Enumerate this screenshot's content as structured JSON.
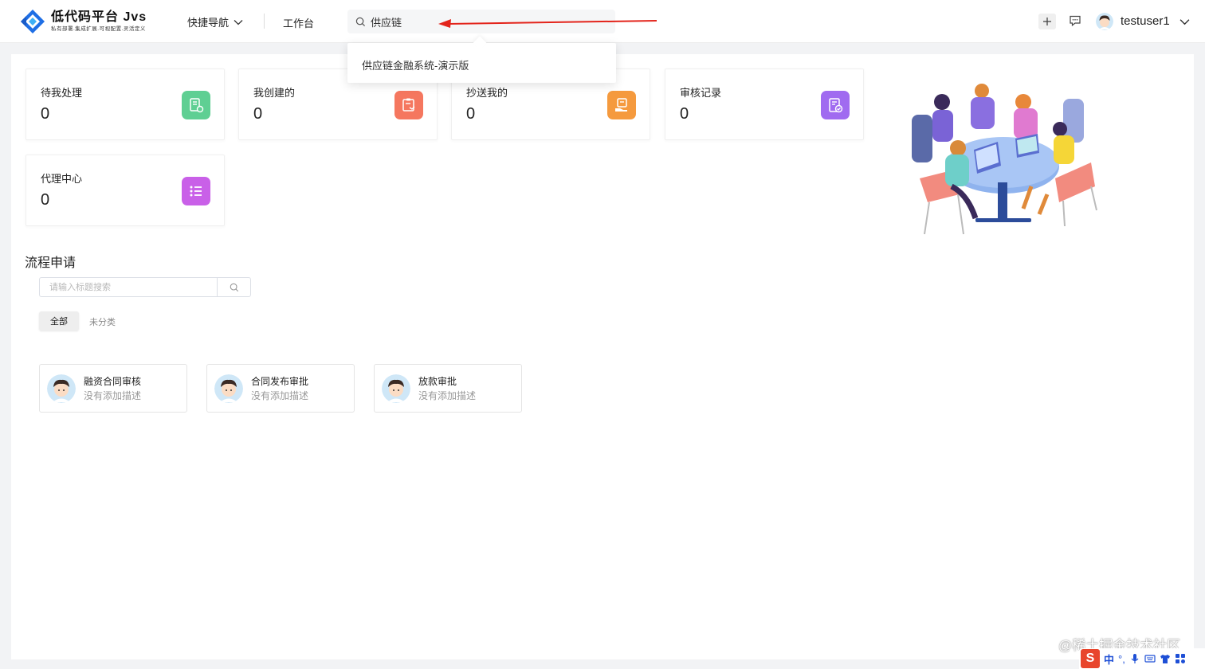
{
  "header": {
    "logo_title": "低代码平台 Jvs",
    "logo_subtitle": "私有部署.集成扩展.可视配置.灵活定义",
    "quick_nav_label": "快捷导航",
    "workbench_label": "工作台",
    "search_value": "供应链",
    "search_suggestion": "供应链金融系统-演示版",
    "username": "testuser1"
  },
  "stats": [
    {
      "label": "待我处理",
      "value": "0",
      "color": "#5fcf93"
    },
    {
      "label": "我创建的",
      "value": "0",
      "color": "#f5775f"
    },
    {
      "label": "抄送我的",
      "value": "0",
      "color": "#f59a3e"
    },
    {
      "label": "审核记录",
      "value": "0",
      "color": "#a06bf0"
    },
    {
      "label": "代理中心",
      "value": "0",
      "color": "#c960e8"
    }
  ],
  "process": {
    "title": "流程申请",
    "search_placeholder": "请输入标题搜索",
    "tab_all": "全部",
    "tab_uncategorized": "未分类",
    "items": [
      {
        "title": "融资合同审核",
        "desc": "没有添加描述"
      },
      {
        "title": "合同发布审批",
        "desc": "没有添加描述"
      },
      {
        "title": "放款审批",
        "desc": "没有添加描述"
      }
    ]
  },
  "watermark": "@稀土掘金技术社区",
  "ime": {
    "logo": "S",
    "mode": "中",
    "punct": "°,"
  }
}
